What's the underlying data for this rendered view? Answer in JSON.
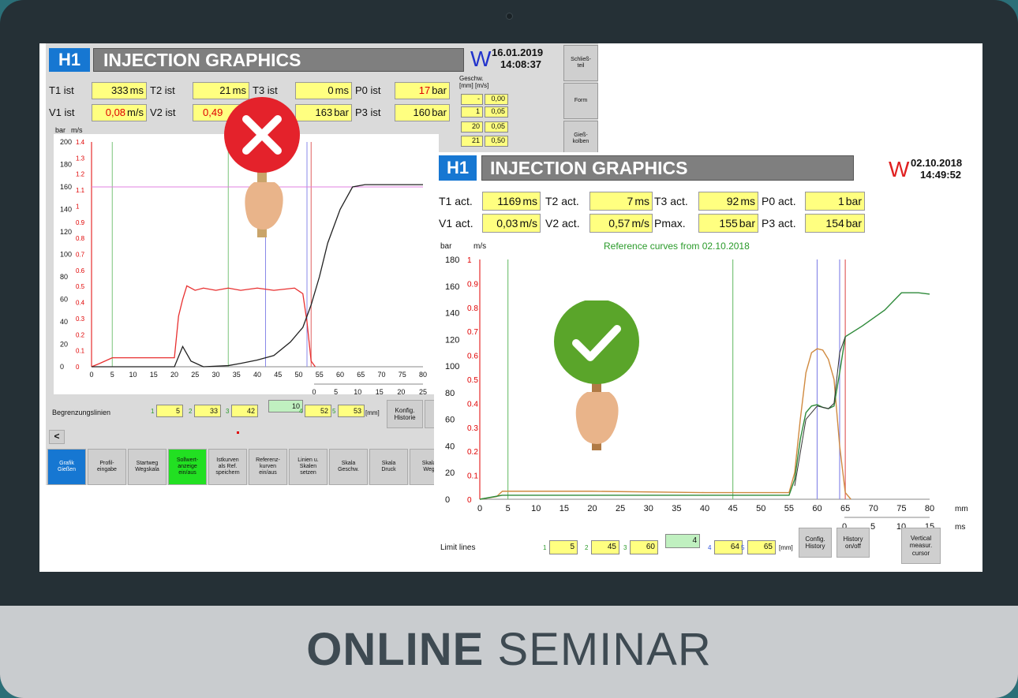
{
  "footer": {
    "bold": "ONLINE",
    "light": "SEMINAR"
  },
  "left": {
    "badge": "H1",
    "title": "INJECTION GRAPHICS",
    "w": "W",
    "date": "16.01.2019",
    "time": "14:08:37",
    "row1": [
      {
        "label": "T1 ist",
        "value": "333",
        "unit": "ms"
      },
      {
        "label": "T2 ist",
        "value": "21",
        "unit": "ms"
      },
      {
        "label": "T3 ist",
        "value": "0",
        "unit": "ms"
      },
      {
        "label": "P0 ist",
        "value": "17",
        "unit": "bar"
      }
    ],
    "row2": [
      {
        "label": "V1 ist",
        "value": "0,08",
        "unit": "m/s"
      },
      {
        "label": "V2 ist",
        "value": "0,49",
        "unit": ""
      },
      {
        "label": "",
        "value": "163",
        "unit": "bar"
      },
      {
        "label": "P3 ist",
        "value": "160",
        "unit": "bar"
      }
    ],
    "speed_table": {
      "header1": "Geschw.",
      "header2": "[mm]  [m/s]",
      "rows": [
        [
          "-",
          "0,00"
        ],
        [
          "1",
          "0,05"
        ],
        [
          "20",
          "0,05"
        ],
        [
          "21",
          "0,50"
        ]
      ]
    },
    "side_buttons": [
      "Schließ-\nteil",
      "Form",
      "Gieß-\nkolben"
    ],
    "axis_units": {
      "bar": "bar",
      "ms": "m/s"
    },
    "limits_label": "Begrenzungslinien",
    "limits": [
      {
        "n": "1",
        "v": "5"
      },
      {
        "n": "2",
        "v": "33"
      },
      {
        "n": "3",
        "v": "42"
      },
      {
        "n": "",
        "v": "10"
      },
      {
        "n": "4",
        "v": "52"
      },
      {
        "n": "5",
        "v": "53"
      }
    ],
    "limits_unit": "[mm]",
    "konfig": "Konfig.\nHistorie",
    "arrow": "<",
    "toolbar": [
      "Grafik\nGießen",
      "Profil-\neingabe",
      "Startweg\nWegskala",
      "Sollwert-\nanzeige\nein/aus",
      "Istkurven\nals Ref.\nspeichern",
      "Referenz-\nkurven\nein/aus",
      "Linien u.\nSkalen\nsetzen",
      "Skala\nGeschw.",
      "Skala\nDruck",
      "Skala\nWeg"
    ],
    "chart": {
      "x_ticks": [
        "0",
        "5",
        "10",
        "15",
        "20",
        "25",
        "30",
        "35",
        "40",
        "45",
        "50",
        "55",
        "60",
        "65",
        "70",
        "75",
        "80"
      ],
      "x2_ticks": [
        "0",
        "5",
        "10",
        "15",
        "20",
        "25"
      ],
      "y_bar_ticks": [
        "0",
        "20",
        "40",
        "60",
        "80",
        "100",
        "120",
        "140",
        "160",
        "180",
        "200"
      ],
      "y_ms_ticks": [
        "0",
        "0.1",
        "0.2",
        "0.3",
        "0.4",
        "0.5",
        "0.6",
        "0.7",
        "0.8",
        "0.9",
        "1",
        "1.1",
        "1.2",
        "1.3",
        "1.4"
      ]
    }
  },
  "right": {
    "badge": "H1",
    "title": "INJECTION GRAPHICS",
    "w": "W",
    "date": "02.10.2018",
    "time": "14:49:52",
    "row1": [
      {
        "label": "T1 act.",
        "value": "1169",
        "unit": "ms"
      },
      {
        "label": "T2 act.",
        "value": "7",
        "unit": "ms"
      },
      {
        "label": "T3 act.",
        "value": "92",
        "unit": "ms"
      },
      {
        "label": "P0 act.",
        "value": "1",
        "unit": "bar"
      }
    ],
    "row2": [
      {
        "label": "V1 act.",
        "value": "0,03",
        "unit": "m/s"
      },
      {
        "label": "V2 act.",
        "value": "0,57",
        "unit": "m/s"
      },
      {
        "label": "Pmax.",
        "value": "155",
        "unit": "bar"
      },
      {
        "label": "P3 act.",
        "value": "154",
        "unit": "bar"
      }
    ],
    "reference_text": "Reference curves from 02.10.2018",
    "axis_units": {
      "bar": "bar",
      "ms": "m/s",
      "mm": "mm",
      "ms_time": "ms"
    },
    "limits_label": "Limit lines",
    "limits": [
      {
        "n": "1",
        "v": "5"
      },
      {
        "n": "2",
        "v": "45"
      },
      {
        "n": "3",
        "v": "60"
      },
      {
        "n": "",
        "v": "4"
      },
      {
        "n": "4",
        "v": "64"
      },
      {
        "n": "5",
        "v": "65"
      }
    ],
    "limits_unit": "[mm]",
    "buttons": [
      "Config.\nHistory",
      "History\non/off",
      "Vertical\nmeasur.\ncursor"
    ],
    "chart": {
      "x_ticks": [
        "0",
        "5",
        "10",
        "15",
        "20",
        "25",
        "30",
        "35",
        "40",
        "45",
        "50",
        "55",
        "60",
        "65",
        "70",
        "75",
        "80"
      ],
      "x2_ticks": [
        "0",
        "5",
        "10",
        "15"
      ],
      "y_bar_ticks": [
        "0",
        "20",
        "40",
        "60",
        "80",
        "100",
        "120",
        "140",
        "160",
        "180"
      ],
      "y_ms_ticks": [
        "0",
        "0.1",
        "0.2",
        "0.3",
        "0.4",
        "0.5",
        "0.6",
        "0.7",
        "0.8",
        "0.9",
        "1"
      ]
    }
  },
  "colors": {
    "accent_blue": "#1677d2",
    "field_yellow": "#ffff80",
    "wrong_red": "#e4222b",
    "ok_green": "#5aa52a"
  }
}
